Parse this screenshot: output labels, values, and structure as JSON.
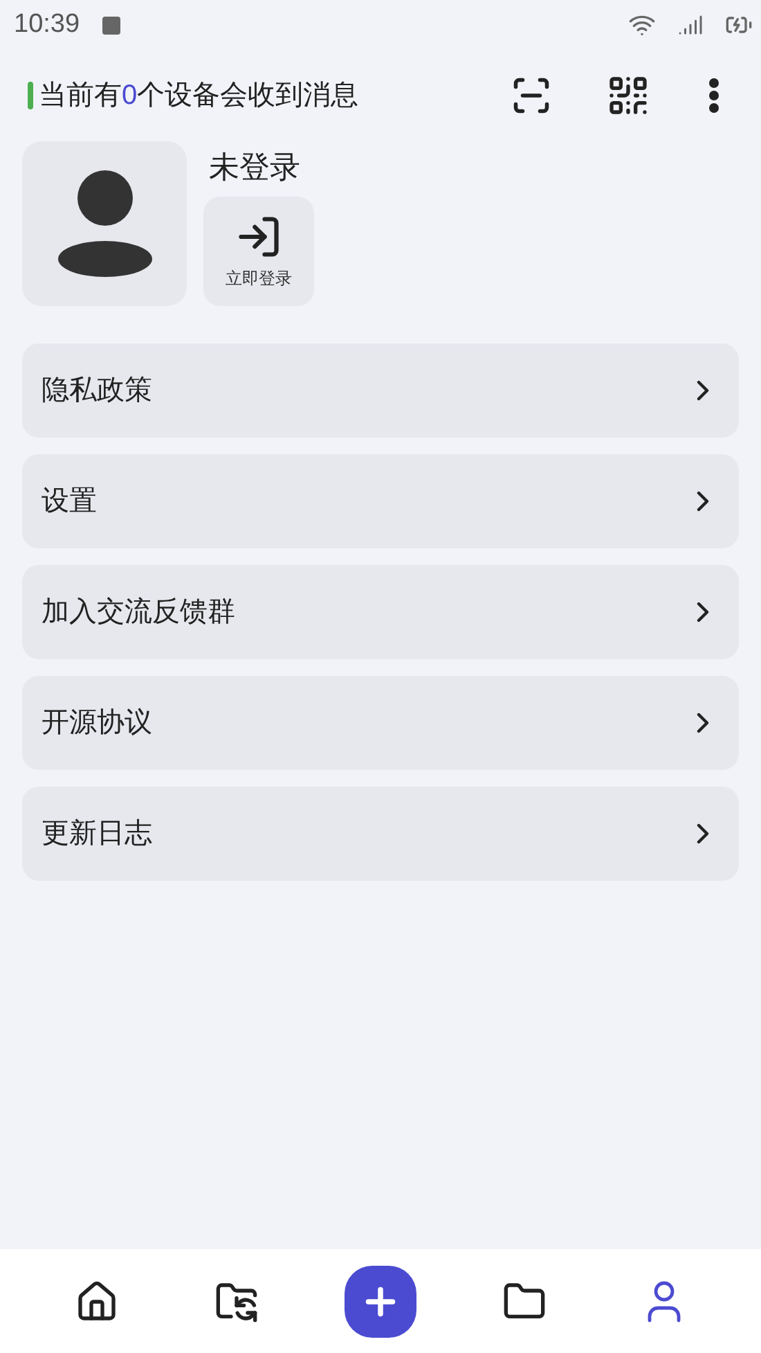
{
  "status_bar": {
    "time": "10:39"
  },
  "header": {
    "prefix": "当前有",
    "count": "0",
    "suffix": "个设备会收到消息",
    "online": true
  },
  "profile": {
    "name": "未登录",
    "login_button": "立即登录"
  },
  "menu": [
    {
      "label": "隐私政策"
    },
    {
      "label": "设置"
    },
    {
      "label": "加入交流反馈群"
    },
    {
      "label": "开源协议"
    },
    {
      "label": "更新日志"
    }
  ],
  "nav": [
    {
      "kind": "home",
      "selected": false
    },
    {
      "kind": "transfer",
      "selected": false
    },
    {
      "kind": "add",
      "selected": false
    },
    {
      "kind": "folder",
      "selected": false
    },
    {
      "kind": "profile",
      "selected": true
    }
  ]
}
